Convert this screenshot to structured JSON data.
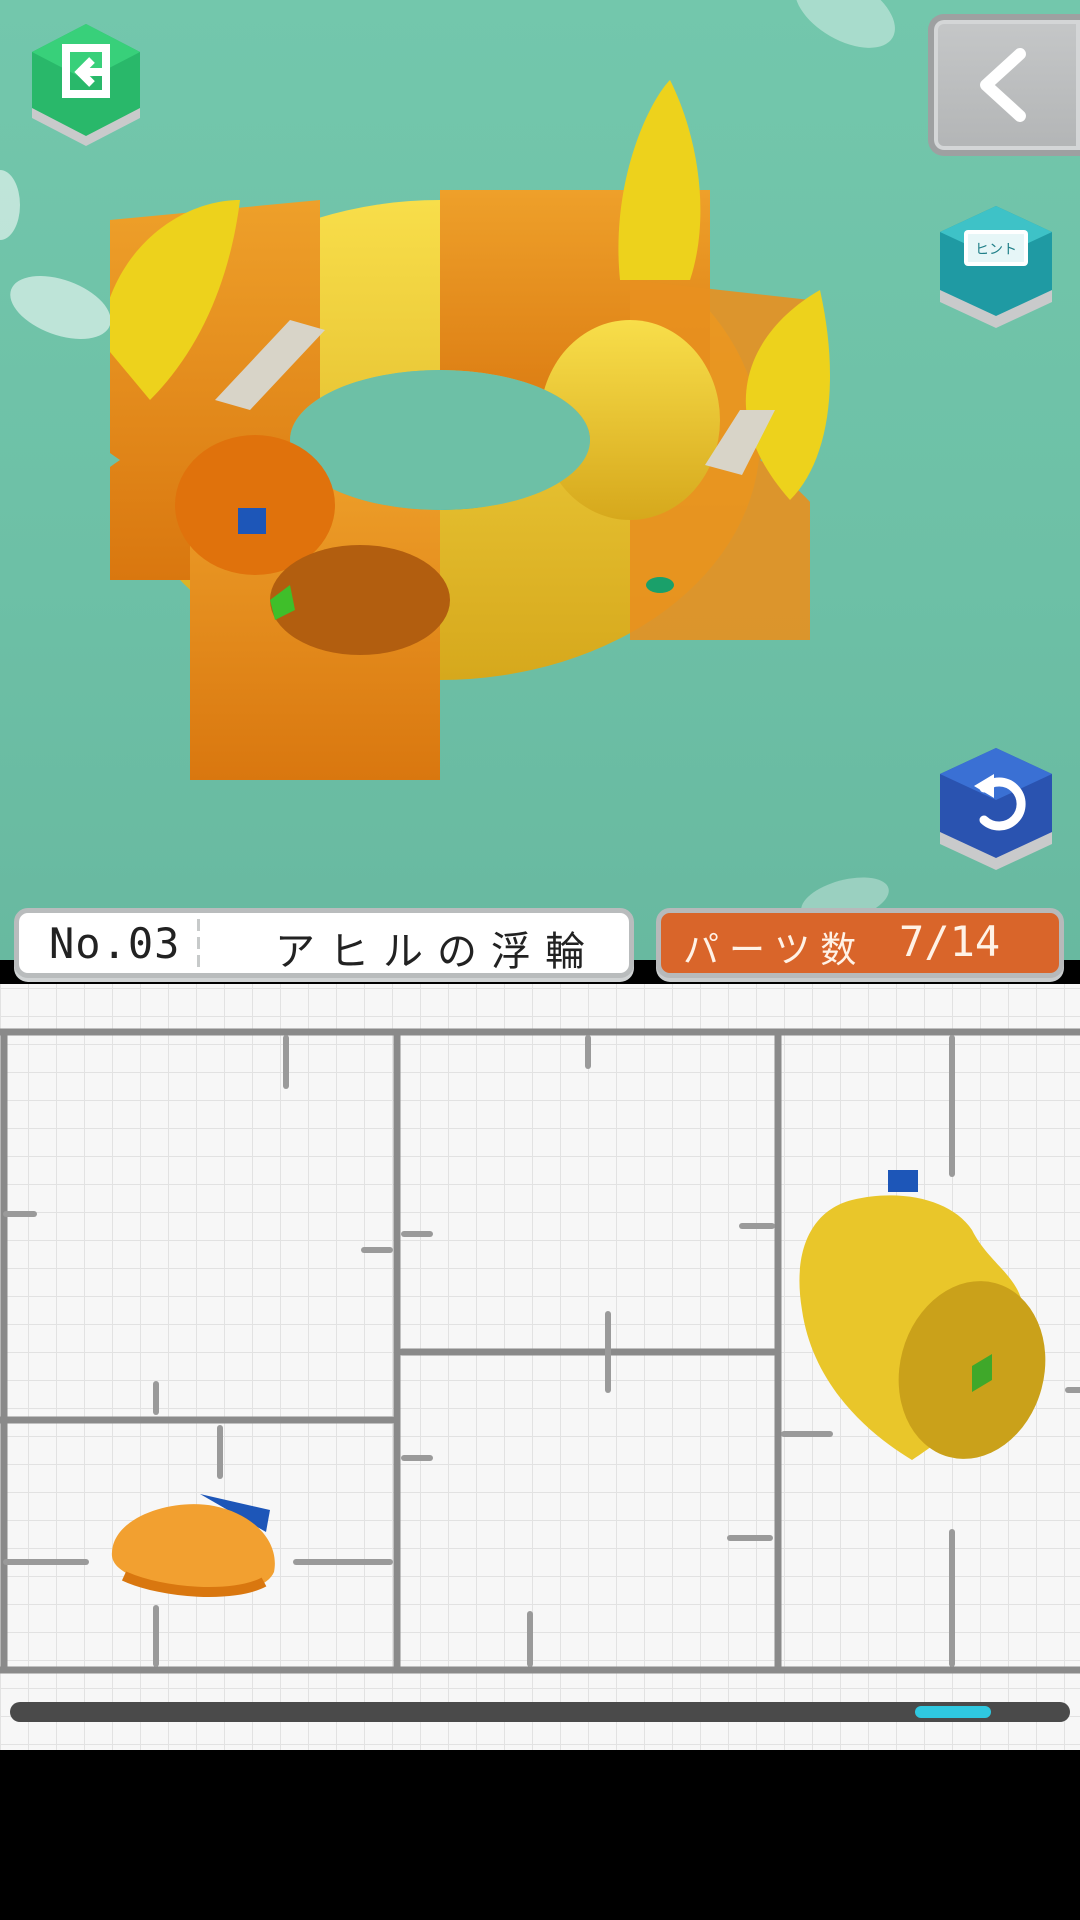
{
  "game": {
    "model_number": "No.03",
    "model_name": "アヒルの浮輪",
    "parts_label": "パーツ数",
    "parts_progress": "7/14"
  },
  "buttons": {
    "exit_icon": "exit-icon",
    "back_icon": "chevron-left-icon",
    "hint_label": "ヒント",
    "undo_icon": "undo-icon"
  },
  "scroll": {
    "position_fraction": 0.92
  },
  "colors": {
    "background": "#73c7ac",
    "ring_orange": "#e8901f",
    "ring_yellow": "#f3cf2e",
    "exit_green": "#2cc46a",
    "hint_teal": "#2aa6b0",
    "undo_blue": "#2f5fbf",
    "parts_panel": "#d9652a",
    "scroll_thumb": "#2fc8e0"
  }
}
